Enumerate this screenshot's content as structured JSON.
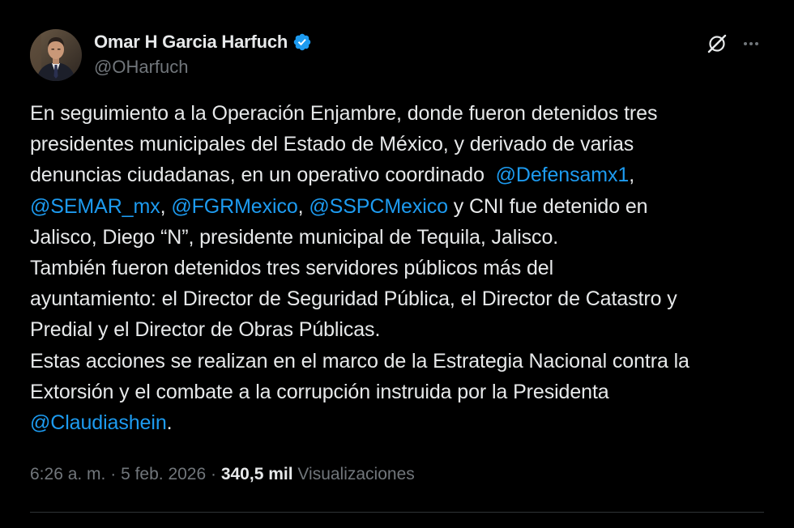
{
  "author": {
    "display_name": "Omar H Garcia Harfuch",
    "handle": "@OHarfuch",
    "verified": true,
    "avatar_icon": "profile-photo"
  },
  "actions": {
    "grok_icon": "grok-icon",
    "more_icon": "more-icon"
  },
  "tweet": {
    "lines": [
      {
        "text": "En seguimiento a la Operación Enjambre, donde fueron detenidos tres"
      },
      {
        "text": "presidentes municipales del Estado de México, y derivado de varias"
      },
      {
        "pre": "denuncias ciudadanas, en un operativo coordinado  ",
        "mention": "@Defensamx1",
        "post": ","
      },
      {
        "m1": "@SEMAR_mx",
        "s1": ", ",
        "m2": "@FGRMexico",
        "s2": ", ",
        "m3": "@SSPCMexico",
        "post": " y CNI fue detenido en"
      },
      {
        "text": "Jalisco, Diego “N”, presidente municipal de Tequila, Jalisco."
      },
      {
        "text": "También fueron detenidos tres servidores públicos más del"
      },
      {
        "text": "ayuntamiento: el Director de Seguridad Pública, el Director de Catastro y"
      },
      {
        "text": "Predial y el Director de Obras Públicas."
      },
      {
        "text": "Estas acciones se realizan en el marco de la Estrategia Nacional contra la"
      },
      {
        "text": "Extorsión y el combate a la corrupción instruida por la Presidenta"
      },
      {
        "mention": "@Claudiashein",
        "post": "."
      }
    ]
  },
  "meta": {
    "time": "6:26 a. m.",
    "sep1": " · ",
    "date": "5 feb. 2026",
    "sep2": " · ",
    "views_count": "340,5 mil",
    "views_label": " Visualizaciones"
  },
  "colors": {
    "background": "#000000",
    "text": "#e7e9ea",
    "secondary": "#71767b",
    "link": "#1d9bf0",
    "divider": "#2f3336"
  }
}
